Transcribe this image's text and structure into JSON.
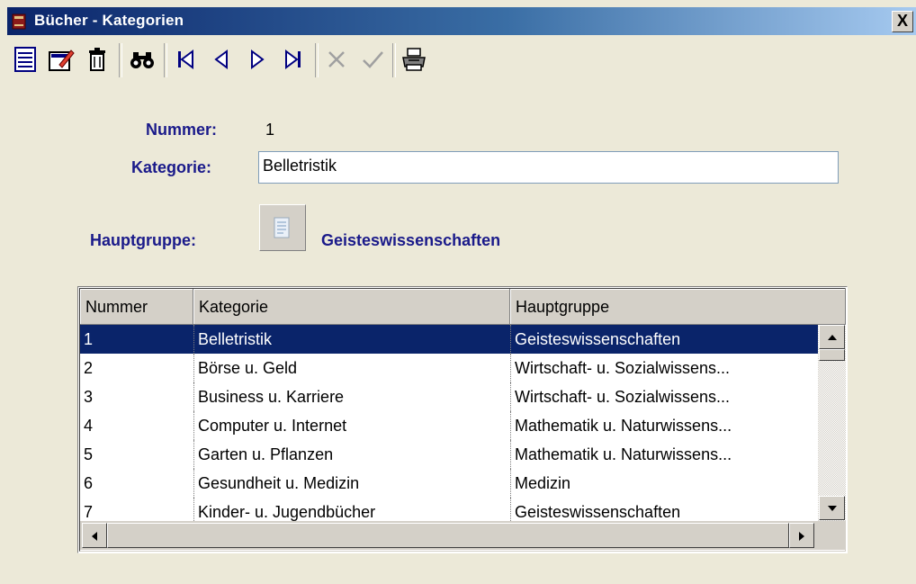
{
  "window": {
    "title": "Bücher - Kategorien",
    "close_label": "X"
  },
  "toolbar": {
    "buttons": [
      {
        "name": "list-view",
        "icon": "list-icon"
      },
      {
        "name": "edit",
        "icon": "edit-form-icon"
      },
      {
        "name": "delete",
        "icon": "trash-icon"
      },
      {
        "name": "search",
        "icon": "binoculars-icon"
      },
      {
        "name": "first",
        "icon": "first-record-icon"
      },
      {
        "name": "previous",
        "icon": "previous-record-icon"
      },
      {
        "name": "next",
        "icon": "next-record-icon"
      },
      {
        "name": "last",
        "icon": "last-record-icon"
      },
      {
        "name": "cancel",
        "icon": "cancel-icon"
      },
      {
        "name": "confirm",
        "icon": "checkmark-icon"
      },
      {
        "name": "print",
        "icon": "printer-icon"
      }
    ]
  },
  "form": {
    "nummer_label": "Nummer:",
    "nummer_value": "1",
    "kategorie_label": "Kategorie:",
    "kategorie_value": "Belletristik",
    "hauptgruppe_label": "Hauptgruppe:",
    "hauptgruppe_value": "Geisteswissenschaften"
  },
  "grid": {
    "columns": [
      "Nummer",
      "Kategorie",
      "Hauptgruppe"
    ],
    "rows": [
      {
        "nummer": "1",
        "kategorie": "Belletristik",
        "hauptgruppe": "Geisteswissenschaften"
      },
      {
        "nummer": "2",
        "kategorie": "Börse u. Geld",
        "hauptgruppe": "Wirtschaft- u. Sozialwissens..."
      },
      {
        "nummer": "3",
        "kategorie": "Business u. Karriere",
        "hauptgruppe": "Wirtschaft- u. Sozialwissens..."
      },
      {
        "nummer": "4",
        "kategorie": "Computer u. Internet",
        "hauptgruppe": "Mathematik u. Naturwissens..."
      },
      {
        "nummer": "5",
        "kategorie": "Garten u. Pflanzen",
        "hauptgruppe": "Mathematik u. Naturwissens..."
      },
      {
        "nummer": "6",
        "kategorie": "Gesundheit u. Medizin",
        "hauptgruppe": "Medizin"
      },
      {
        "nummer": "7",
        "kategorie": "Kinder- u. Jugendbücher",
        "hauptgruppe": "Geisteswissenschaften"
      }
    ],
    "selected_row": 0
  },
  "colors": {
    "selection": "#0a246a",
    "label": "#1a1a8a",
    "window_bg": "#ece9d8"
  }
}
